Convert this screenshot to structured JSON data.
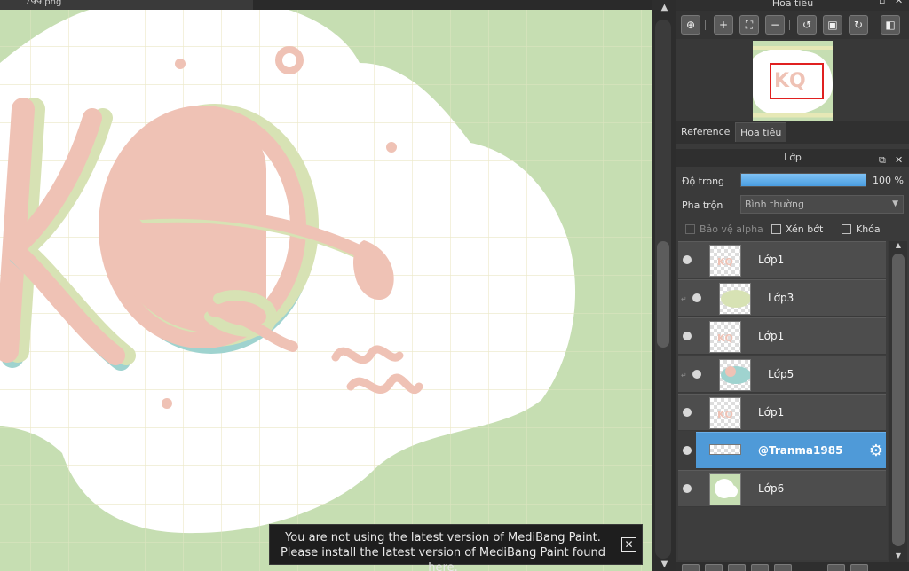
{
  "file_tab": {
    "label": "799.png"
  },
  "canvas": {
    "background_color": "#c6deb2",
    "cloud_color": "#ffffff",
    "lettering_color": "#efc2b5",
    "shadow_green": "#d7e2b4",
    "shadow_blue": "#9fd3cf",
    "grid_color": "#ece9c9"
  },
  "toast": {
    "line1": "You are not using the latest version of MediBang Paint.",
    "line2": "Please install the latest version of MediBang Paint found here.",
    "close_icon": "close-icon"
  },
  "navigator": {
    "title": "Hoa tiêu",
    "tools": [
      "zoom-actual-icon",
      "zoom-in-icon",
      "fit-icon",
      "zoom-out-icon",
      "rotate-left-icon",
      "fullscreen-icon",
      "rotate-right-icon",
      "flip-icon"
    ]
  },
  "panel_tabs": [
    {
      "label": "Reference",
      "active": false
    },
    {
      "label": "Hoa tiêu",
      "active": true
    }
  ],
  "layer_panel": {
    "title": "Lớp",
    "opacity_label": "Độ trong",
    "opacity_value": "100 %",
    "opacity_fraction": 1.0,
    "blend_label": "Pha trộn",
    "blend_value": "Bình thường",
    "protect_alpha": "Bảo vệ alpha",
    "clip": "Xén bớt",
    "lock": "Khóa",
    "layers": [
      {
        "name": "Lớp1",
        "clipped": false,
        "selected": false,
        "thumb": "ko"
      },
      {
        "name": "Lớp3",
        "clipped": true,
        "selected": false,
        "thumb": "green-blob"
      },
      {
        "name": "Lớp1",
        "clipped": false,
        "selected": false,
        "thumb": "ko"
      },
      {
        "name": "Lớp5",
        "clipped": true,
        "selected": false,
        "thumb": "blue-blob"
      },
      {
        "name": "Lớp1",
        "clipped": false,
        "selected": false,
        "thumb": "ko"
      },
      {
        "name": "@Tranma1985",
        "clipped": false,
        "selected": true,
        "thumb": "text-strip"
      },
      {
        "name": "Lớp6",
        "clipped": false,
        "selected": false,
        "thumb": "cloud"
      }
    ]
  }
}
